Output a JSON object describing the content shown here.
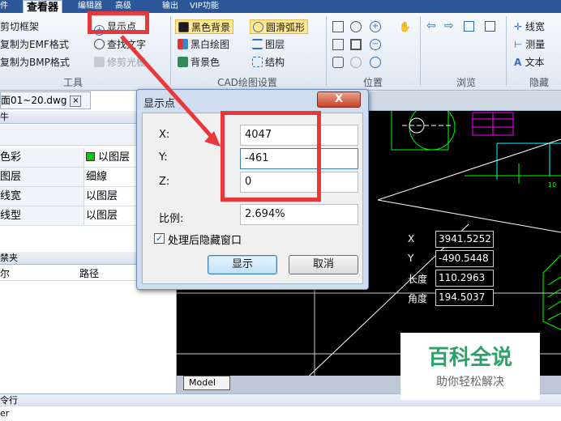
{
  "menu_tabs": [
    "件",
    "查看器",
    "编辑器",
    "高级",
    "输出",
    "VIP功能"
  ],
  "ribbon": {
    "tools": {
      "items": [
        "剪切框架",
        "复制为EMF格式",
        "复制为BMP格式"
      ],
      "col2": [
        "显示点",
        "查找文字",
        "修剪光栅"
      ],
      "label": "工具"
    },
    "cad_settings": {
      "col1": [
        "黑色背景",
        "黑白绘图",
        "背景色"
      ],
      "col2": [
        "圆滑弧形",
        "图层",
        "结构"
      ],
      "label": "CAD绘图设置"
    },
    "position_label": "位置",
    "browse_label": "浏览",
    "hide": {
      "items": [
        "线宽",
        "测量",
        "文本"
      ],
      "label": "隐藏"
    }
  },
  "document_tab": "面01~20.dwg",
  "left_panel": {
    "header_top": "牛",
    "properties": [
      {
        "key": "色彩",
        "value": "以图层",
        "swatch": "#00cc00"
      },
      {
        "key": "图层",
        "value": "细線"
      },
      {
        "key": "线宽",
        "value": "以图层"
      },
      {
        "key": "线型",
        "value": "以图层"
      }
    ],
    "section2_header": "禁夹",
    "columns": [
      "尔",
      "路径"
    ]
  },
  "dialog": {
    "title": "显示点",
    "close_symbol": "X",
    "fields": [
      {
        "label": "X:",
        "value": "4047"
      },
      {
        "label": "Y:",
        "value": "-461"
      },
      {
        "label": "Z:",
        "value": "0"
      }
    ],
    "scale_label": "比例:",
    "scale_value": "2.694%",
    "checkbox_label": "处理后隐藏窗口",
    "checkbox_checked": true,
    "ok": "显示",
    "cancel": "取消"
  },
  "readout": [
    {
      "label": "X",
      "value": "3941.5252"
    },
    {
      "label": "Y",
      "value": "-490.5448"
    },
    {
      "label": "长度",
      "value": "110.2963"
    },
    {
      "label": "角度",
      "value": "194.5037"
    }
  ],
  "canvas_labels": [
    "10"
  ],
  "model_tab": "Model",
  "command_bar": "令行",
  "command_line": "er",
  "watermark": {
    "title": "百科全说",
    "subtitle": "助你轻松解决"
  },
  "colors": {
    "highlight_red": "#e8383a",
    "canvas_bg": "#000000",
    "cad_cyan": "#00ffff",
    "cad_green": "#00ff00"
  }
}
